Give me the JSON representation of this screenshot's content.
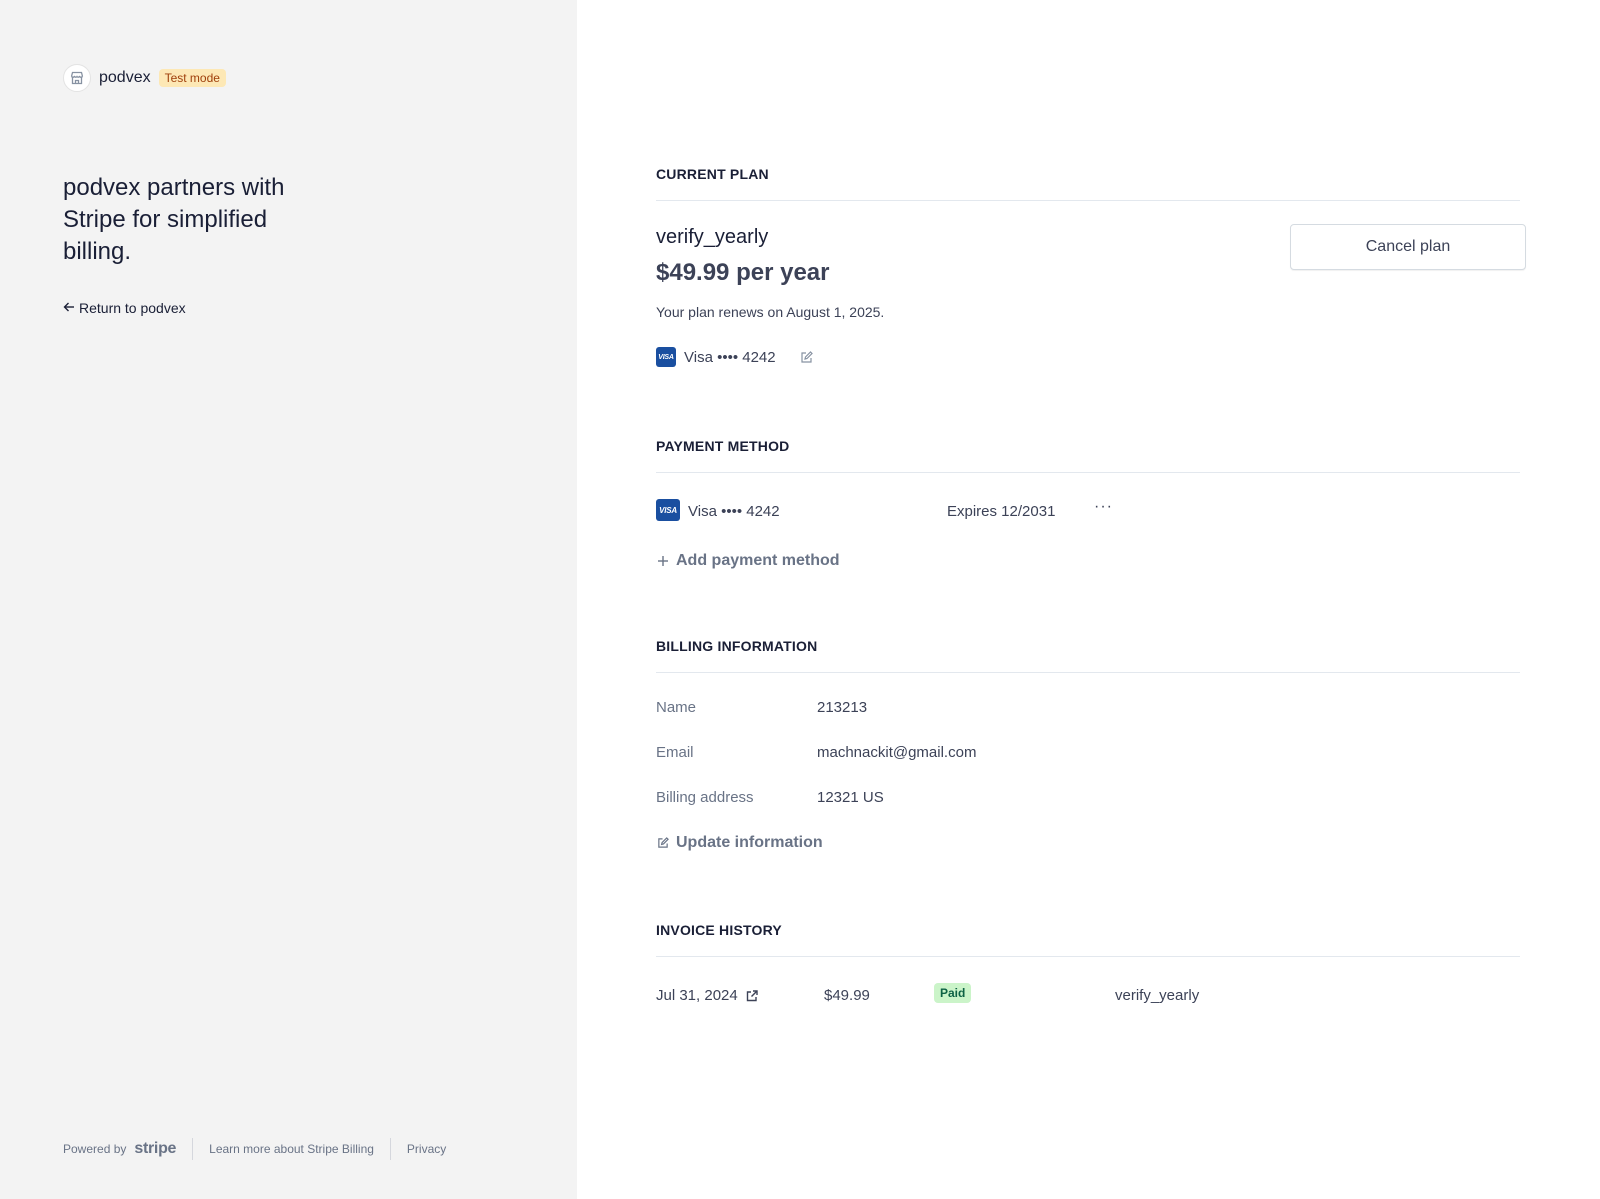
{
  "brand": {
    "name": "podvex",
    "mode_badge": "Test mode",
    "logo_icon": "storefront-icon"
  },
  "sidebar": {
    "tagline": "podvex partners with Stripe for simplified billing.",
    "return_link": "Return to podvex"
  },
  "footer": {
    "powered_by": "Powered by",
    "stripe": "stripe",
    "learn_more": "Learn more about Stripe Billing",
    "privacy": "Privacy"
  },
  "current_plan": {
    "title": "CURRENT PLAN",
    "plan_name": "verify_yearly",
    "price": "$49.99 per year",
    "renewal": "Your plan renews on August 1, 2025.",
    "card_brand": "VISA",
    "card": "Visa •••• 4242",
    "cancel_label": "Cancel plan"
  },
  "payment_method": {
    "title": "PAYMENT METHOD",
    "card_brand": "VISA",
    "card": "Visa •••• 4242",
    "expires": "Expires 12/2031",
    "more": "···",
    "add_label": "Add payment method"
  },
  "billing_info": {
    "title": "BILLING INFORMATION",
    "rows": [
      {
        "label": "Name",
        "value": "213213"
      },
      {
        "label": "Email",
        "value": "machnackit@gmail.com"
      },
      {
        "label": "Billing address",
        "value": "12321 US"
      }
    ],
    "update_label": "Update information"
  },
  "invoice_history": {
    "title": "INVOICE HISTORY",
    "rows": [
      {
        "date": "Jul 31, 2024",
        "amount": "$49.99",
        "status": "Paid",
        "plan": "verify_yearly"
      }
    ]
  },
  "colors": {
    "sidebar_bg": "#f3f3f3",
    "test_badge_bg": "#fde8b5",
    "paid_badge_bg": "#cbf4c9",
    "visa_blue": "#1a4fa0"
  }
}
